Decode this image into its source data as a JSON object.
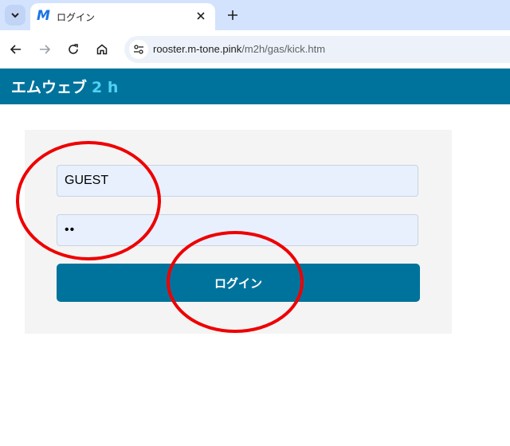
{
  "browser": {
    "tab": {
      "title": "ログイン",
      "favicon": "M"
    },
    "address": {
      "host": "rooster.m-tone.pink",
      "path": "/m2h/gas/kick.htm"
    },
    "icons": {
      "tab_menu": "chevron-down-icon",
      "tab_close": "close-icon",
      "new_tab": "plus-icon",
      "back": "back-arrow-icon",
      "forward": "forward-arrow-icon",
      "reload": "reload-icon",
      "home": "home-icon",
      "site_info": "tune-icon"
    }
  },
  "site": {
    "title": "エムウェブ",
    "title_suffix": "2 h",
    "header_color": "#00739c",
    "suffix_color": "#4fd2f3"
  },
  "login": {
    "username_value": "GUEST",
    "password_value": "••",
    "button_label": "ログイン"
  },
  "annotations": {
    "color": "#ee0000",
    "count": 2
  }
}
